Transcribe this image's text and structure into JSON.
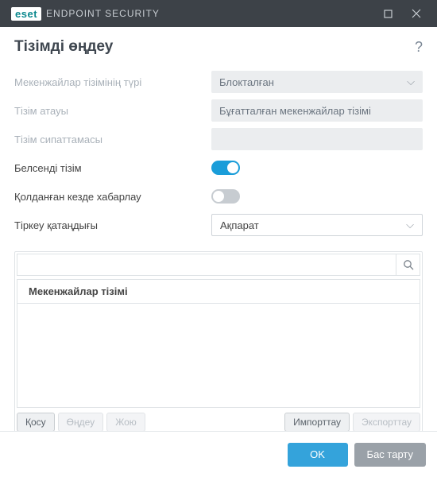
{
  "titlebar": {
    "brand": "eset",
    "product": "ENDPOINT SECURITY"
  },
  "page": {
    "title": "Тізімді өңдеу"
  },
  "form": {
    "address_list_type_label": "Мекенжайлар тізімінің түрі",
    "address_list_type_value": "Блокталған",
    "list_name_label": "Тізім атауы",
    "list_name_value": "Бұғатталған мекенжайлар тізімі",
    "list_description_label": "Тізім сипаттамасы",
    "list_description_value": "",
    "active_list_label": "Белсенді тізім",
    "notify_label": "Қолданған кезде хабарлау",
    "log_severity_label": "Тіркеу қатаңдығы",
    "log_severity_value": "Ақпарат"
  },
  "list": {
    "header": "Мекенжайлар тізімі",
    "search_placeholder": ""
  },
  "actions": {
    "add": "Қосу",
    "edit": "Өңдеу",
    "delete": "Жою",
    "import": "Импорттау",
    "export": "Экспорттау"
  },
  "footer": {
    "ok": "OK",
    "cancel": "Бас тарту"
  }
}
